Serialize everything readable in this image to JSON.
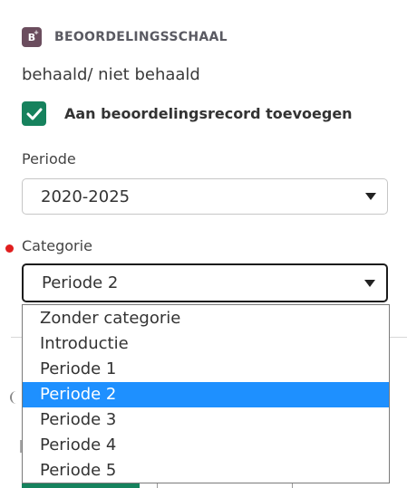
{
  "section": {
    "icon": "grade-scale-icon",
    "icon_text": "B",
    "icon_sup": "+",
    "title": "BEOORDELINGSSCHAAL"
  },
  "scale_value": "behaald/ niet behaald",
  "record_checkbox": {
    "label": "Aan beoordelingsrecord toevoegen",
    "checked": true,
    "color": "#16825d"
  },
  "period": {
    "label": "Periode",
    "value": "2020-2025"
  },
  "category": {
    "label": "Categorie",
    "required": true,
    "value": "Periode 2",
    "options": [
      "Zonder categorie",
      "Introductie",
      "Periode 1",
      "Periode 2",
      "Periode 3",
      "Periode 4",
      "Periode 5"
    ],
    "selected_index": 3
  },
  "colors": {
    "accent": "#16825d",
    "selection": "#1e90ff",
    "required": "#e01e1e"
  }
}
